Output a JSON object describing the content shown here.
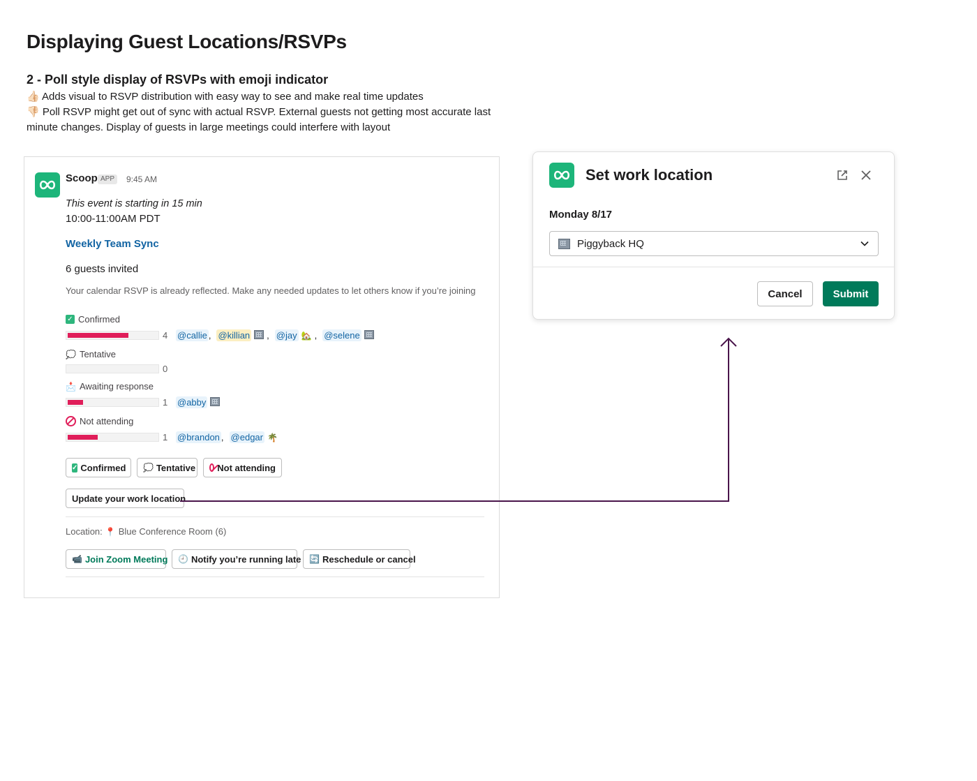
{
  "header": {
    "title": "Displaying Guest Locations/RSVPs",
    "subtitle": "2 - Poll style display of RSVPs with emoji indicator",
    "pro": "Adds visual to RSVP distribution with easy way to see and make real time updates",
    "con": "Poll RSVP might get out of sync with actual RSVP. External guests not getting most accurate last minute changes. Display of guests in large meetings could interfere with layout"
  },
  "message": {
    "sender": "Scoop",
    "badge": "APP",
    "time": "9:45 AM",
    "starting_note": "This event is starting in 15 min",
    "time_range": "10:00-11:00AM PDT",
    "event_name": "Weekly Team Sync",
    "guests_invited": "6 guests invited",
    "rsvp_note": "Your calendar RSVP is already reflected. Make any needed updates to let others know if you’re joining",
    "sections": [
      {
        "label": "Confirmed",
        "icon": "check-icon",
        "count": "4",
        "fraction": 0.667,
        "mentions": [
          "@callie",
          "@killian",
          "@jay",
          "@selene"
        ]
      },
      {
        "label": "Tentative",
        "icon": "speech-bubble-icon",
        "count": "0",
        "fraction": 0,
        "mentions": []
      },
      {
        "label": "Awaiting response",
        "icon": "envelope-icon",
        "count": "1",
        "fraction": 0.167,
        "mentions": [
          "@abby"
        ]
      },
      {
        "label": "Not attending",
        "icon": "no-entry-icon",
        "count": "1",
        "fraction": 0.333,
        "mentions": [
          "@brandon",
          "@edgar"
        ]
      }
    ],
    "buttons": {
      "confirmed": "Confirmed",
      "tentative": "Tentative",
      "not_attending": "Not attending",
      "update_location": "Update your work location"
    },
    "location_label": "Location:",
    "location_value": "Blue Conference Room (6)",
    "actions": {
      "join_zoom": "Join Zoom Meeting",
      "running_late": "Notify you’re running late",
      "reschedule": "Reschedule or cancel"
    },
    "bar_color": "#e01e5a"
  },
  "modal": {
    "title": "Set work location",
    "date": "Monday 8/17",
    "selected_location": "Piggyback HQ",
    "cancel": "Cancel",
    "submit": "Submit",
    "accent": "#007a5a"
  },
  "colors": {
    "app_icon": "#1db57a",
    "link": "#1264a3",
    "connector": "#4a154b"
  }
}
